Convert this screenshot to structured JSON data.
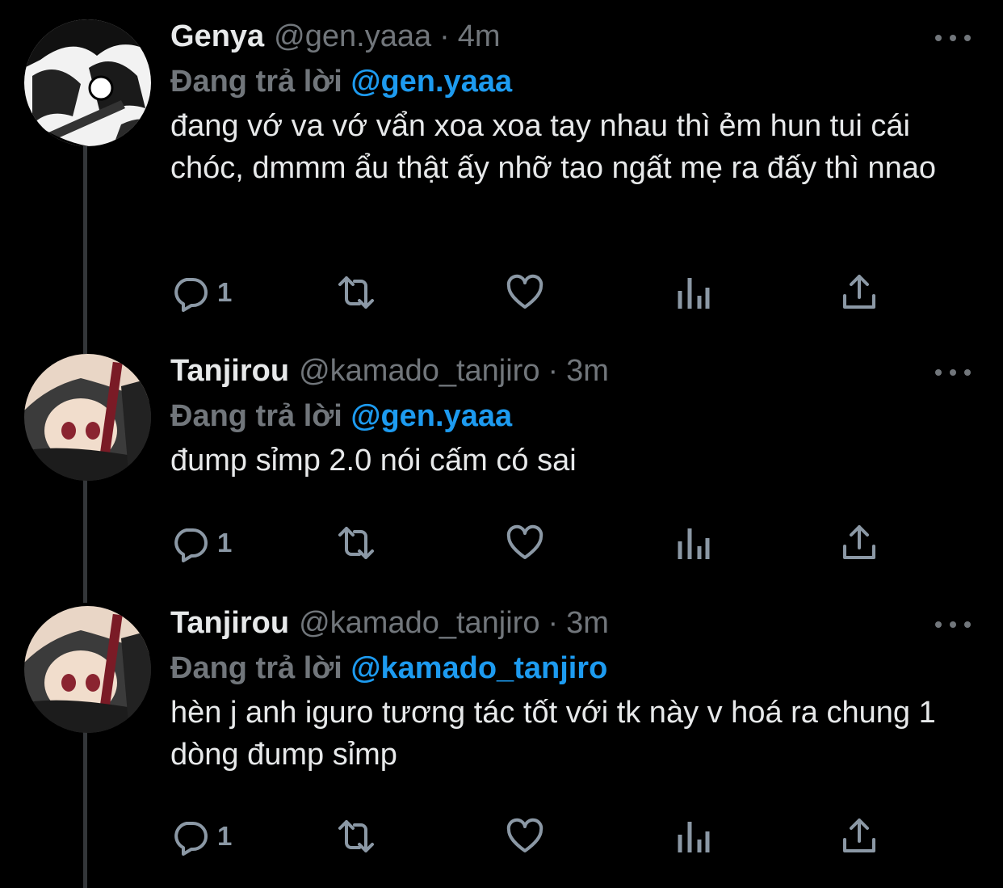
{
  "tweets": [
    {
      "name": "Genya",
      "handle": "@gen.yaaa",
      "separator": "·",
      "time": "4m",
      "reply_prefix": "Đang trả lời",
      "reply_to": "@gen.yaaa",
      "text": "đang vớ va vớ vẩn xoa xoa tay nhau thì ẻm hun tui cái chóc, dmmm ẩu thật ấy nhỡ tao ngất mẹ ra đấy thì nnao",
      "reply_count": "1"
    },
    {
      "name": "Tanjirou",
      "handle": "@kamado_tanjiro",
      "separator": "·",
      "time": "3m",
      "reply_prefix": "Đang trả lời",
      "reply_to": "@gen.yaaa",
      "text": "đump sỉmp 2.0 nói cấm có sai",
      "reply_count": "1"
    },
    {
      "name": "Tanjirou",
      "handle": "@kamado_tanjiro",
      "separator": "·",
      "time": "3m",
      "reply_prefix": "Đang trả lời",
      "reply_to": "@kamado_tanjiro",
      "text": "hèn j anh iguro tương tác tốt với tk này v hoá ra chung 1 dòng đump sỉmp",
      "reply_count": "1"
    }
  ],
  "icons": {
    "reply": "reply-icon",
    "retweet": "retweet-icon",
    "like": "heart-icon",
    "views": "analytics-icon",
    "share": "share-icon",
    "more": "more-icon"
  },
  "colors": {
    "background": "#000000",
    "text": "#e7e9ea",
    "muted": "#71767b",
    "mention": "#1d9bf0",
    "thread_line": "#333639"
  }
}
